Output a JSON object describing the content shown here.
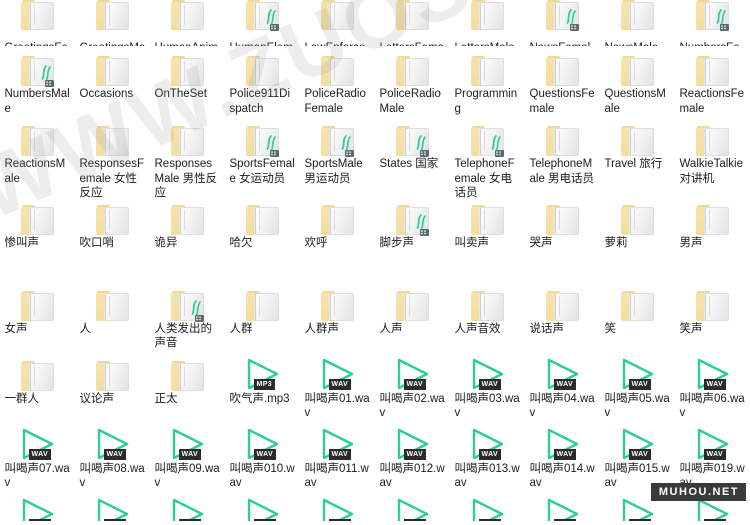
{
  "window": {
    "view_mode": "large-icons",
    "columns": 10
  },
  "watermarks": {
    "diagonal": "WWW.ZUOSHIPIN.COM",
    "badge": "MUHOU.NET"
  },
  "colors": {
    "folder_yellow": "#f3dd9e",
    "folder_front": "#f0f0f0",
    "media_teal": "#2ecc9b",
    "badge_dark": "#2b2b2b",
    "label_text": "#1c1c1c",
    "background": "#ffffff"
  },
  "rows": [
    {
      "clip": "top",
      "items": [
        {
          "type": "folder",
          "sound": false,
          "label": "GreetingsFemale 女性问候"
        },
        {
          "type": "folder",
          "sound": false,
          "label": "GreetingsMale 男性问候"
        },
        {
          "type": "folder",
          "sound": false,
          "label": "HumanAnimals"
        },
        {
          "type": "folder",
          "sound": true,
          "label": "HumanElements"
        },
        {
          "type": "folder",
          "sound": false,
          "label": "LawEnforcement 执法"
        },
        {
          "type": "folder",
          "sound": false,
          "label": "LettersFemale"
        },
        {
          "type": "folder",
          "sound": false,
          "label": "LettersMale 字母男"
        },
        {
          "type": "folder",
          "sound": true,
          "label": "NewsFemale"
        },
        {
          "type": "folder",
          "sound": false,
          "label": "NewsMale"
        },
        {
          "type": "folder",
          "sound": true,
          "label": "NumbersFemale"
        }
      ]
    },
    {
      "items": [
        {
          "type": "folder",
          "sound": true,
          "label": "NumbersMale"
        },
        {
          "type": "folder",
          "sound": false,
          "label": "Occasions"
        },
        {
          "type": "folder",
          "sound": false,
          "label": "OnTheSet"
        },
        {
          "type": "folder",
          "sound": false,
          "label": "Police911Dispatch"
        },
        {
          "type": "folder",
          "sound": false,
          "label": "PoliceRadioFemale"
        },
        {
          "type": "folder",
          "sound": false,
          "label": "PoliceRadioMale"
        },
        {
          "type": "folder",
          "sound": false,
          "label": "Programming"
        },
        {
          "type": "folder",
          "sound": false,
          "label": "QuestionsFemale"
        },
        {
          "type": "folder",
          "sound": false,
          "label": "QuestionsMale"
        },
        {
          "type": "folder",
          "sound": false,
          "label": "ReactionsFemale"
        }
      ]
    },
    {
      "items": [
        {
          "type": "folder",
          "sound": false,
          "label": "ReactionsMale"
        },
        {
          "type": "folder",
          "sound": false,
          "label": "ResponsesFemale 女性反应"
        },
        {
          "type": "folder",
          "sound": false,
          "label": "ResponsesMale 男性反应"
        },
        {
          "type": "folder",
          "sound": true,
          "label": "SportsFemale 女运动员"
        },
        {
          "type": "folder",
          "sound": true,
          "label": "SportsMale 男运动员"
        },
        {
          "type": "folder",
          "sound": true,
          "label": "States 国家"
        },
        {
          "type": "folder",
          "sound": true,
          "label": "TelephoneFemale 女电话员"
        },
        {
          "type": "folder",
          "sound": false,
          "label": "TelephoneMale 男电话员"
        },
        {
          "type": "folder",
          "sound": false,
          "label": "Travel 旅行"
        },
        {
          "type": "folder",
          "sound": false,
          "label": "WalkieTalkie 对讲机"
        }
      ]
    },
    {
      "height": "h80",
      "items": [
        {
          "type": "folder",
          "sound": false,
          "label": "惨叫声"
        },
        {
          "type": "folder",
          "sound": false,
          "label": "吹口哨"
        },
        {
          "type": "folder",
          "sound": false,
          "label": "诡异"
        },
        {
          "type": "folder",
          "sound": false,
          "label": "哈欠"
        },
        {
          "type": "folder",
          "sound": false,
          "label": "欢呼"
        },
        {
          "type": "folder",
          "sound": true,
          "label": "脚步声"
        },
        {
          "type": "folder",
          "sound": false,
          "label": "叫卖声"
        },
        {
          "type": "folder",
          "sound": false,
          "label": "哭声"
        },
        {
          "type": "folder",
          "sound": false,
          "label": "萝莉"
        },
        {
          "type": "folder",
          "sound": false,
          "label": "男声"
        }
      ]
    },
    {
      "items": [
        {
          "type": "folder",
          "sound": false,
          "label": "女声"
        },
        {
          "type": "folder",
          "sound": false,
          "label": "人"
        },
        {
          "type": "folder",
          "sound": true,
          "label": "人类发出的声音"
        },
        {
          "type": "folder",
          "sound": false,
          "label": "人群"
        },
        {
          "type": "folder",
          "sound": false,
          "label": "人群声"
        },
        {
          "type": "folder",
          "sound": false,
          "label": "人声"
        },
        {
          "type": "folder",
          "sound": false,
          "label": "人声音效"
        },
        {
          "type": "folder",
          "sound": false,
          "label": "说话声"
        },
        {
          "type": "folder",
          "sound": false,
          "label": "笑"
        },
        {
          "type": "folder",
          "sound": false,
          "label": "笑声"
        }
      ]
    },
    {
      "items": [
        {
          "type": "folder",
          "sound": false,
          "label": "一群人"
        },
        {
          "type": "folder",
          "sound": false,
          "label": "议论声"
        },
        {
          "type": "folder",
          "sound": false,
          "label": "正太"
        },
        {
          "type": "media",
          "format": "MP3",
          "label": "吹气声.mp3"
        },
        {
          "type": "media",
          "format": "WAV",
          "label": "叫喝声01.wav"
        },
        {
          "type": "media",
          "format": "WAV",
          "label": "叫喝声02.wav"
        },
        {
          "type": "media",
          "format": "WAV",
          "label": "叫喝声03.wav"
        },
        {
          "type": "media",
          "format": "WAV",
          "label": "叫喝声04.wav"
        },
        {
          "type": "media",
          "format": "WAV",
          "label": "叫喝声05.wav"
        },
        {
          "type": "media",
          "format": "WAV",
          "label": "叫喝声06.wav"
        }
      ]
    },
    {
      "items": [
        {
          "type": "media",
          "format": "WAV",
          "label": "叫喝声07.wav"
        },
        {
          "type": "media",
          "format": "WAV",
          "label": "叫喝声08.wav"
        },
        {
          "type": "media",
          "format": "WAV",
          "label": "叫喝声09.wav"
        },
        {
          "type": "media",
          "format": "WAV",
          "label": "叫喝声010.wav"
        },
        {
          "type": "media",
          "format": "WAV",
          "label": "叫喝声011.wav"
        },
        {
          "type": "media",
          "format": "WAV",
          "label": "叫喝声012.wav"
        },
        {
          "type": "media",
          "format": "WAV",
          "label": "叫喝声013.wav"
        },
        {
          "type": "media",
          "format": "WAV",
          "label": "叫喝声014.wav"
        },
        {
          "type": "media",
          "format": "WAV",
          "label": "叫喝声015.wav"
        },
        {
          "type": "media",
          "format": "WAV",
          "label": "叫喝声019.wav"
        }
      ]
    },
    {
      "clip": "bottom",
      "items": [
        {
          "type": "media",
          "format": "WAV",
          "label": ""
        },
        {
          "type": "media",
          "format": "WAV",
          "label": ""
        },
        {
          "type": "media",
          "format": "WAV",
          "label": ""
        },
        {
          "type": "media",
          "format": "WAV",
          "label": ""
        },
        {
          "type": "media",
          "format": "WAV",
          "label": ""
        },
        {
          "type": "media",
          "format": "WAV",
          "label": ""
        },
        {
          "type": "media",
          "format": "WAV",
          "label": ""
        },
        {
          "type": "media",
          "format": "WAV",
          "label": ""
        },
        {
          "type": "media",
          "format": "WAV",
          "label": ""
        },
        {
          "type": "media",
          "format": "WAV",
          "label": ""
        }
      ]
    }
  ]
}
